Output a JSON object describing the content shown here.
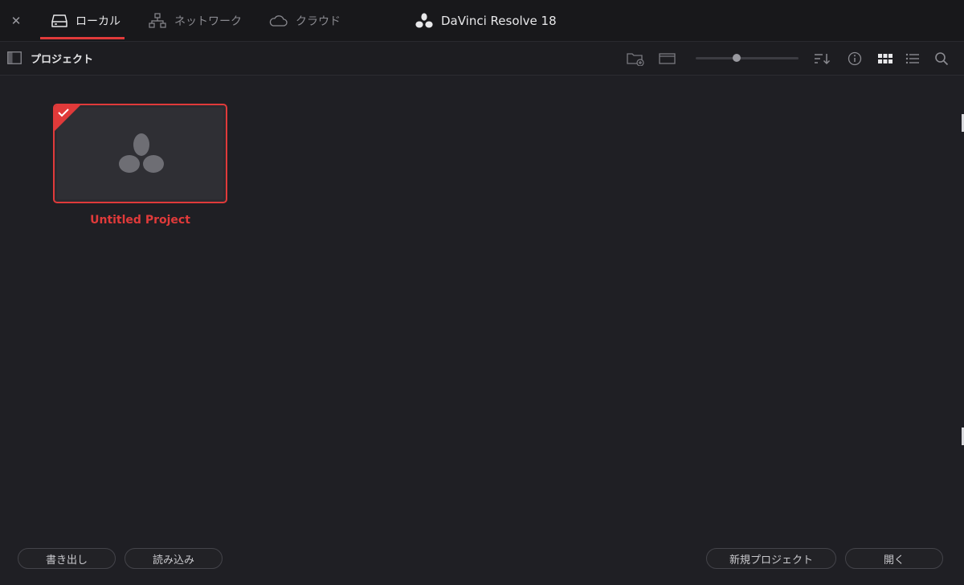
{
  "app": {
    "title": "DaVinci Resolve 18"
  },
  "tabs": [
    {
      "label": "ローカル",
      "icon": "drive-icon",
      "active": true
    },
    {
      "label": "ネットワーク",
      "icon": "network-icon",
      "active": false
    },
    {
      "label": "クラウド",
      "icon": "cloud-icon",
      "active": false
    }
  ],
  "toolbar": {
    "title": "プロジェクト",
    "icons": [
      "new-folder-icon",
      "folder-view-icon",
      "sort-icon",
      "info-icon",
      "grid-view-icon",
      "list-view-icon",
      "search-icon"
    ],
    "zoom_slider_value": 0.4
  },
  "projects": [
    {
      "name": "Untitled Project",
      "selected": true
    }
  ],
  "bottom": {
    "export_label": "書き出し",
    "import_label": "読み込み",
    "new_project_label": "新規プロジェクト",
    "open_label": "開く"
  },
  "colors": {
    "accent": "#e03a3a",
    "background": "#1f1f24",
    "topbar": "#18181b"
  }
}
